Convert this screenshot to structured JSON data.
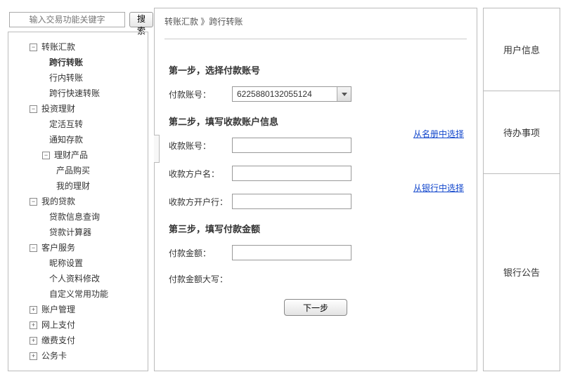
{
  "search": {
    "placeholder": "输入交易功能关键字",
    "button": "搜索"
  },
  "nav": {
    "n0": {
      "label": "转账汇款",
      "expanded": true
    },
    "n0_0": "跨行转账",
    "n0_1": "行内转账",
    "n0_2": "跨行快速转账",
    "n1": {
      "label": "投资理财",
      "expanded": true
    },
    "n1_0": "定活互转",
    "n1_1": "通知存款",
    "n1_2": {
      "label": "理财产品",
      "expanded": true
    },
    "n1_2_0": "产品购买",
    "n1_2_1": "我的理财",
    "n2": {
      "label": "我的贷款",
      "expanded": true
    },
    "n2_0": "贷款信息查询",
    "n2_1": "贷款计算器",
    "n3": {
      "label": "客户服务",
      "expanded": true
    },
    "n3_0": "昵称设置",
    "n3_1": "个人资料修改",
    "n3_2": "自定义常用功能",
    "n4": {
      "label": "账户管理",
      "expanded": false
    },
    "n5": {
      "label": "网上支付",
      "expanded": false
    },
    "n6": {
      "label": "缴费支付",
      "expanded": false
    },
    "n7": {
      "label": "公务卡",
      "expanded": false
    }
  },
  "breadcrumb": "转账汇款 》跨行转账",
  "form": {
    "step1_title": "第一步，选择付款账号",
    "payer_account_label": "付款账号：",
    "payer_account_value": "6225880132055124",
    "step2_title": "第二步，填写收款账户信息",
    "payee_account_label": "收款账号：",
    "payee_name_label": "收款方户名：",
    "payee_bank_label": "收款方开户行：",
    "link_addressbook": "从名册中选择",
    "link_bank": "从银行中选择",
    "step3_title": "第三步，填写付款金额",
    "amount_label": "付款金额：",
    "amount_words_label": "付款金额大写：",
    "next_button": "下一步"
  },
  "right": {
    "user_info": "用户信息",
    "todo": "待办事项",
    "notice": "银行公告"
  }
}
